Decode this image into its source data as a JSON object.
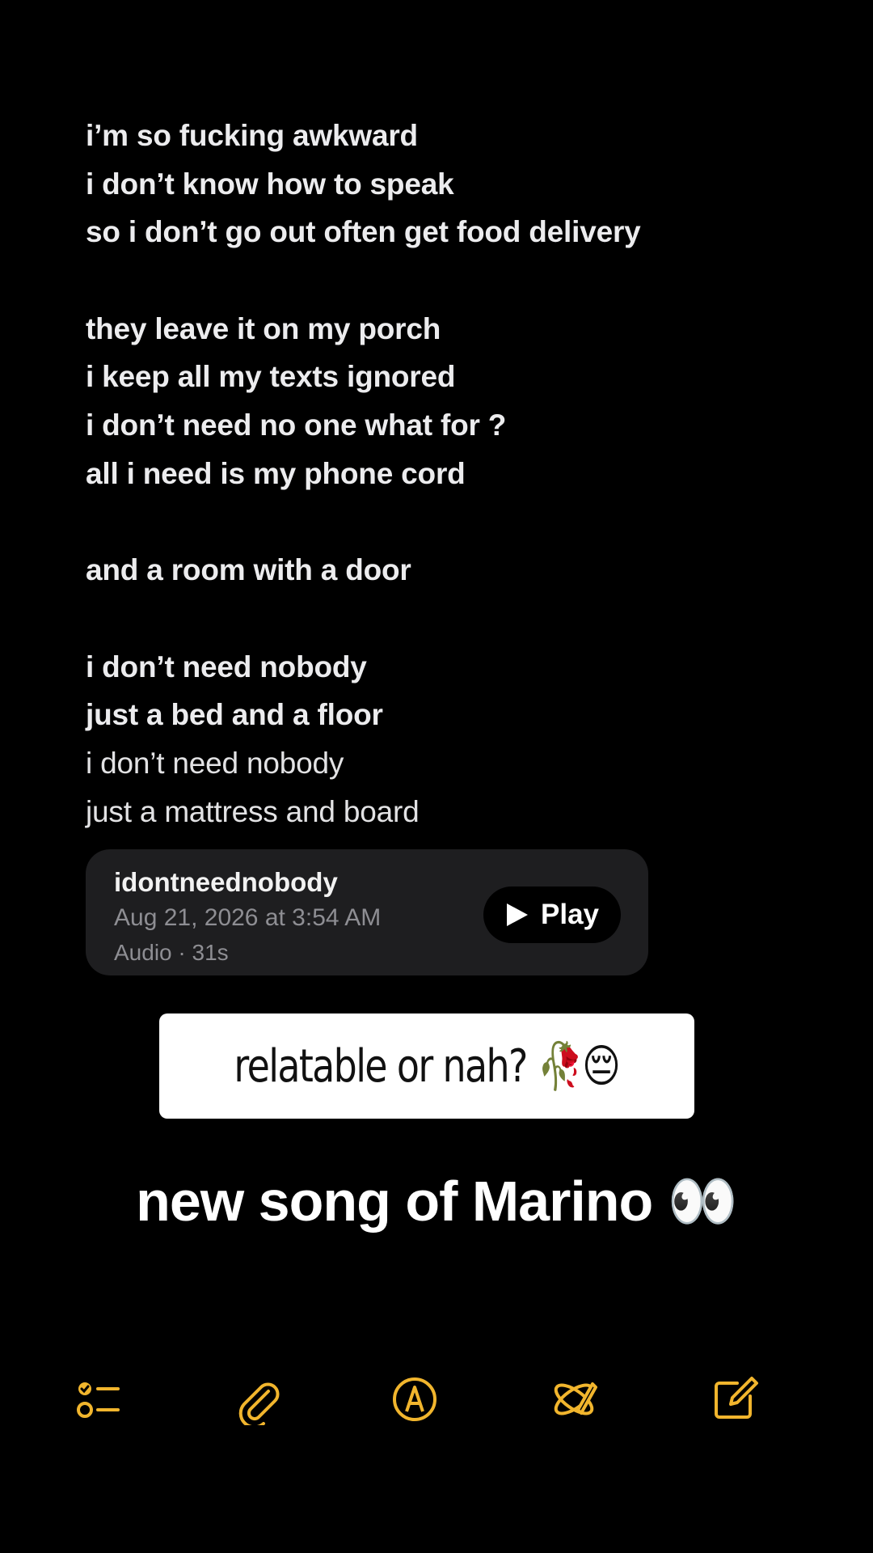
{
  "note": {
    "lyrics": [
      {
        "text": "i’m so fucking awkward",
        "style": "bold"
      },
      {
        "text": "i don’t know how to speak",
        "style": "bold"
      },
      {
        "text": "so i don’t go out often get food delivery",
        "style": "bold"
      },
      {
        "text": "",
        "style": "bold"
      },
      {
        "text": "they leave it on my porch",
        "style": "bold"
      },
      {
        "text": "i keep all my texts ignored",
        "style": "bold"
      },
      {
        "text": "i don’t need no one what for ?",
        "style": "bold"
      },
      {
        "text": "all i need is my phone cord",
        "style": "bold"
      },
      {
        "text": "",
        "style": "bold"
      },
      {
        "text": "and a room with a door",
        "style": "bold"
      },
      {
        "text": "",
        "style": "bold"
      },
      {
        "text": "i don’t need nobody",
        "style": "bold"
      },
      {
        "text": "just a bed and a floor",
        "style": "bold"
      },
      {
        "text": "i don’t need nobody",
        "style": "regular"
      },
      {
        "text": "just a mattress and board",
        "style": "regular"
      }
    ]
  },
  "audio": {
    "title": "idontneednobody",
    "date": "Aug 21, 2026 at 3:54 AM",
    "meta": "Audio · 31s",
    "play_label": "Play"
  },
  "caption": {
    "text": "relatable or nah? 🥀😔"
  },
  "overlay": {
    "text": "new song of Marino 👀"
  },
  "toolbar": {
    "accent_color": "#f1b52d",
    "icons": [
      "checklist-icon",
      "paperclip-icon",
      "markup-pen-icon",
      "apple-intelligence-writing-icon",
      "compose-icon"
    ]
  }
}
